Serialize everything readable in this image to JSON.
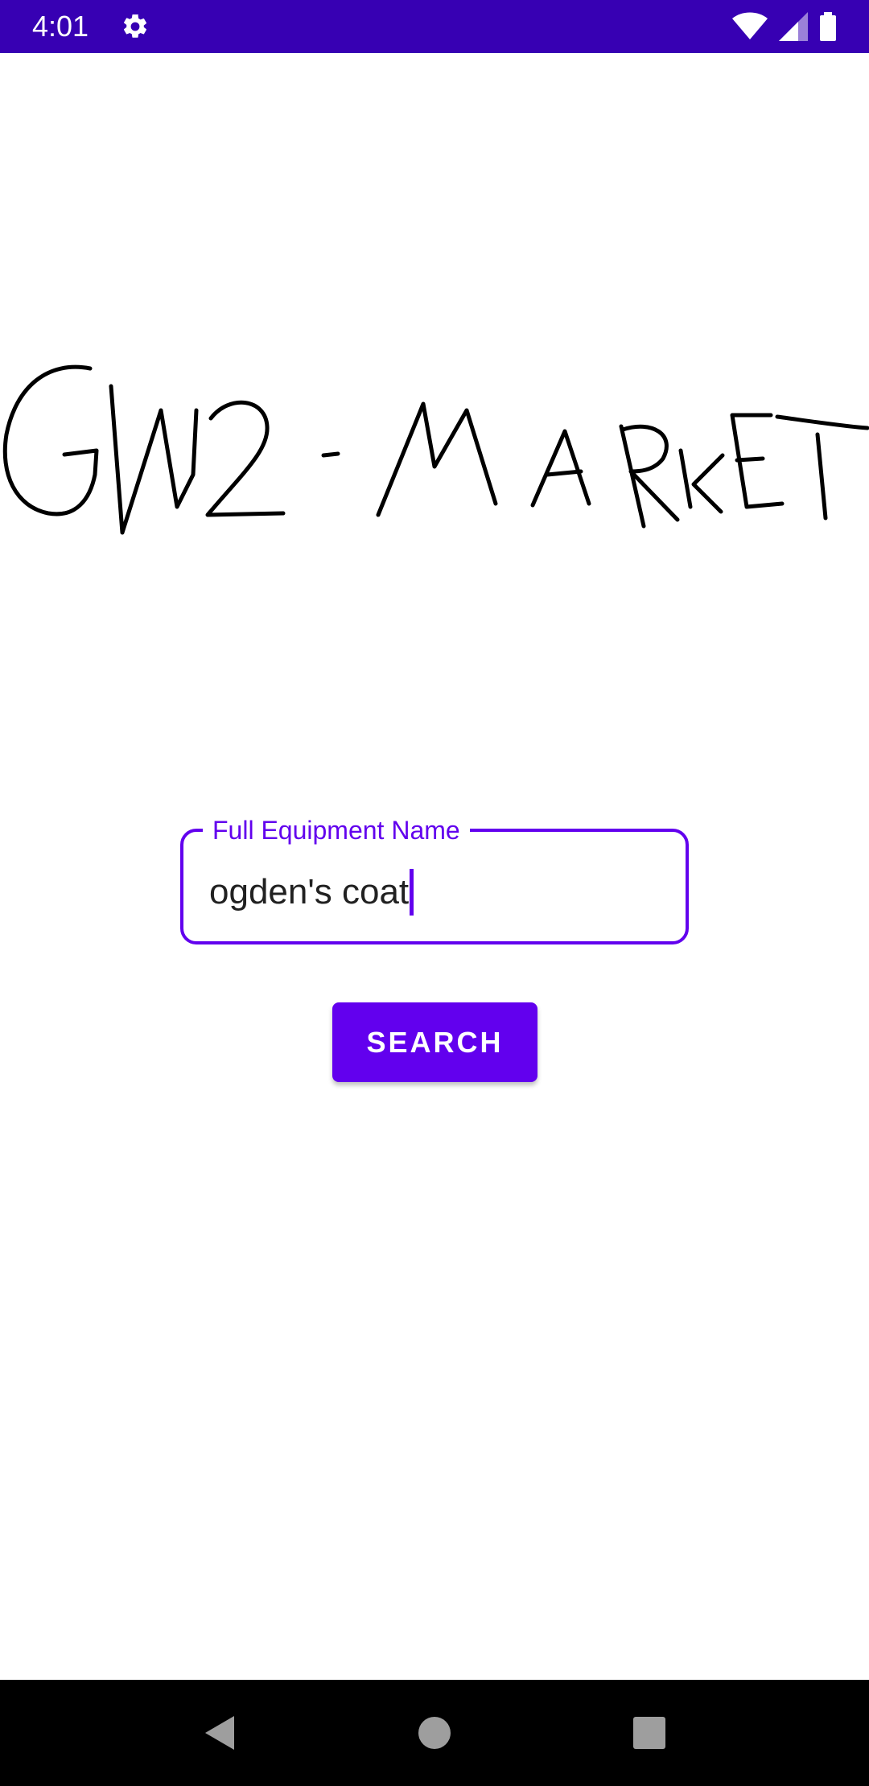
{
  "status_bar": {
    "time": "4:01",
    "background": "#3700B3",
    "icons": [
      "settings-icon",
      "wifi-icon",
      "signal-icon",
      "battery-icon"
    ]
  },
  "logo": {
    "text": "GW2-MARKET"
  },
  "search_field": {
    "label": "Full Equipment Name",
    "value": "ogden's coat",
    "accent": "#6200EE"
  },
  "search_button": {
    "label": "SEARCH",
    "color": "#6200EE"
  },
  "nav_bar": {
    "icons": [
      "back-icon",
      "home-icon",
      "recents-icon"
    ]
  }
}
